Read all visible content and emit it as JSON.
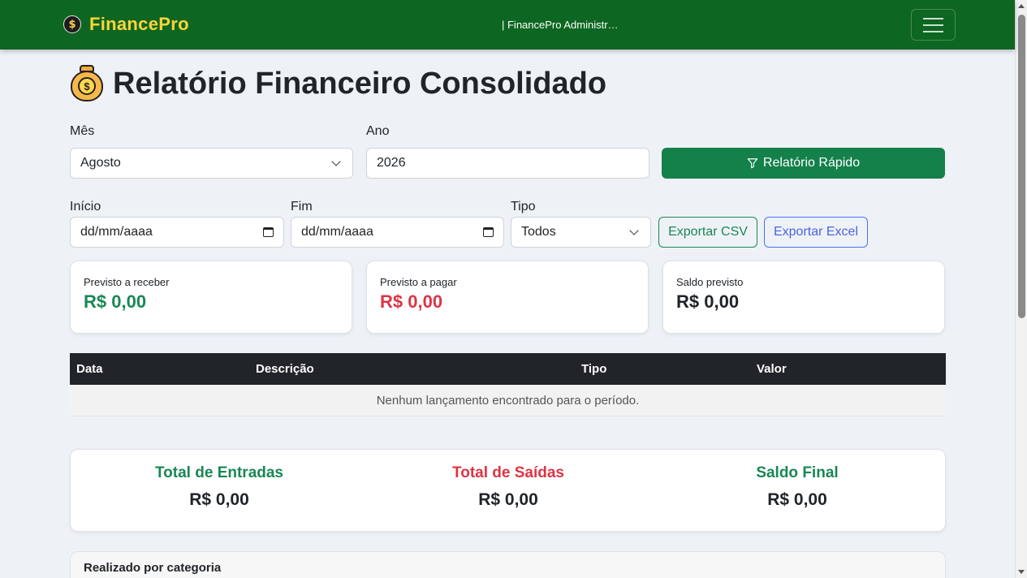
{
  "navbar": {
    "brand": "FinancePro",
    "brand_icon": "dollar-coin-icon",
    "center_text": "| FinancePro Administr…"
  },
  "page": {
    "title": "Relatório Financeiro Consolidado"
  },
  "filters": {
    "month_label": "Mês",
    "month_value": "Agosto",
    "year_label": "Ano",
    "year_value": "2026",
    "quick_report_label": "Relatório Rápido",
    "start_label": "Início",
    "start_placeholder": "dd/mm/aaaa",
    "end_label": "Fim",
    "end_placeholder": "dd/mm/aaaa",
    "type_label": "Tipo",
    "type_value": "Todos",
    "export_csv_label": "Exportar CSV",
    "export_excel_label": "Exportar Excel"
  },
  "cards": [
    {
      "label": "Previsto a receber",
      "value": "R$ 0,00",
      "color": "#198754"
    },
    {
      "label": "Previsto a pagar",
      "value": "R$ 0,00",
      "color": "#dc3545"
    },
    {
      "label": "Saldo previsto",
      "value": "R$ 0,00",
      "color": "#212529"
    }
  ],
  "table": {
    "headers": [
      "Data",
      "Descrição",
      "Tipo",
      "Valor"
    ],
    "empty_message": "Nenhum lançamento encontrado para o período."
  },
  "totals": [
    {
      "label": "Total de Entradas",
      "value": "R$ 0,00",
      "color": "#198754"
    },
    {
      "label": "Total de Saídas",
      "value": "R$ 0,00",
      "color": "#dc3545"
    },
    {
      "label": "Saldo Final",
      "value": "R$ 0,00",
      "color": "#198754"
    }
  ],
  "category_section": {
    "title": "Realizado por categoria"
  }
}
